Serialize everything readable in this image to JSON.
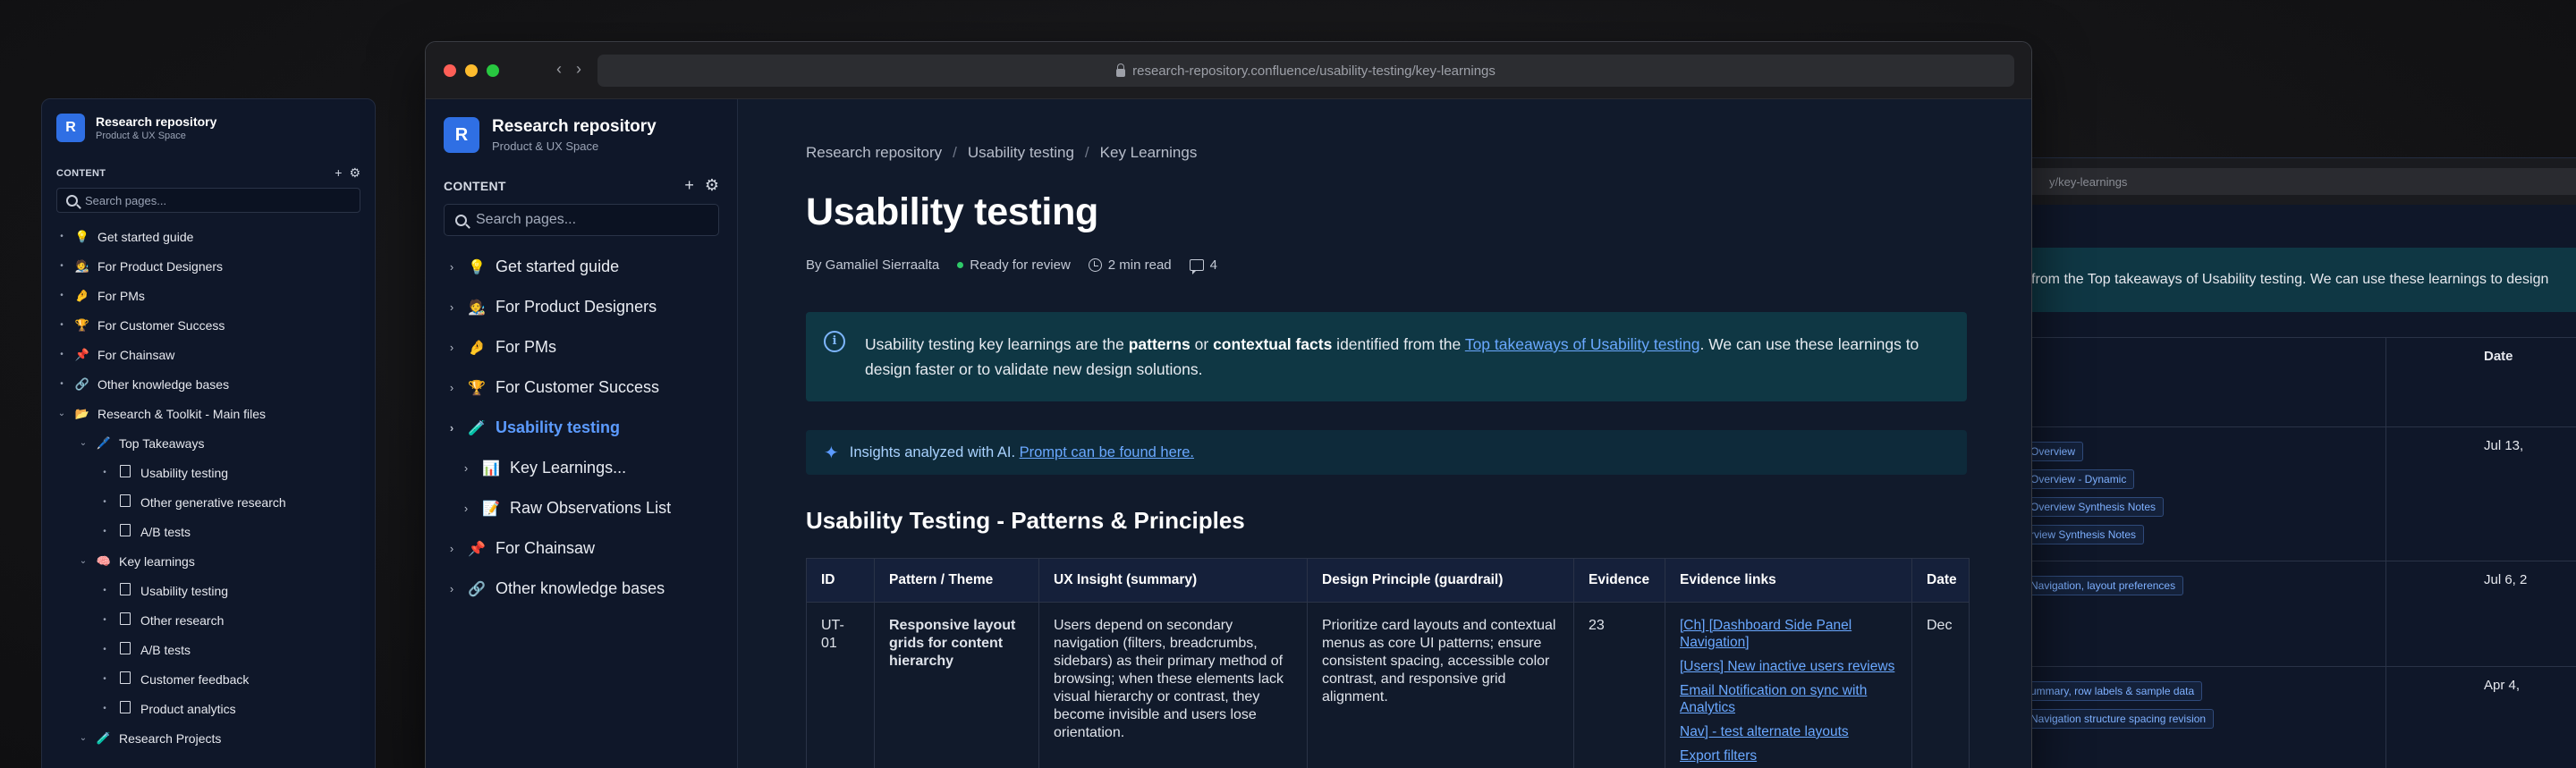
{
  "left_window": {
    "title": "Research repository",
    "subtitle": "Product & UX Space",
    "logo_letter": "R",
    "content_label": "CONTENT",
    "search_placeholder": "Search pages...",
    "items": [
      {
        "emoji": "💡",
        "label": "Get started guide",
        "level": 0,
        "chev": "•"
      },
      {
        "emoji": "🧑‍🎨",
        "label": "For Product Designers",
        "level": 0,
        "chev": "•"
      },
      {
        "emoji": "🤌",
        "label": "For PMs",
        "level": 0,
        "chev": "•"
      },
      {
        "emoji": "🏆",
        "label": "For Customer Success",
        "level": 0,
        "chev": "•"
      },
      {
        "emoji": "📌",
        "label": "For Chainsaw",
        "level": 0,
        "chev": "•"
      },
      {
        "emoji": "🔗",
        "label": "Other knowledge bases",
        "level": 0,
        "chev": "•"
      },
      {
        "emoji": "📂",
        "label": "Research & Toolkit - Main files",
        "level": 0,
        "chev": "⌄"
      },
      {
        "emoji": "🖊️",
        "label": "Top Takeaways",
        "level": 1,
        "chev": "⌄"
      },
      {
        "emoji": "doc",
        "label": "Usability testing",
        "level": 2,
        "chev": "•"
      },
      {
        "emoji": "doc",
        "label": "Other generative research",
        "level": 2,
        "chev": "•"
      },
      {
        "emoji": "doc",
        "label": "A/B tests",
        "level": 2,
        "chev": "•"
      },
      {
        "emoji": "🧠",
        "label": "Key learnings",
        "level": 1,
        "chev": "⌄"
      },
      {
        "emoji": "doc",
        "label": "Usability testing",
        "level": 2,
        "chev": "•"
      },
      {
        "emoji": "doc",
        "label": "Other research",
        "level": 2,
        "chev": "•"
      },
      {
        "emoji": "doc",
        "label": "A/B tests",
        "level": 2,
        "chev": "•"
      },
      {
        "emoji": "doc",
        "label": "Customer feedback",
        "level": 2,
        "chev": "•"
      },
      {
        "emoji": "doc",
        "label": "Product analytics",
        "level": 2,
        "chev": "•"
      },
      {
        "emoji": "🧪",
        "label": "Research Projects",
        "level": 1,
        "chev": "⌄"
      }
    ]
  },
  "right_window": {
    "url_fragment": "y/key-learnings",
    "callout_text": "from the Top takeaways of Usability testing. We can use these learnings to design",
    "date_header": "Date",
    "rows": [
      {
        "date": "Jul 13,",
        "chips": [
          "Overview",
          "Overview - Dynamic",
          "Overview Synthesis Notes",
          "rview Synthesis Notes"
        ]
      },
      {
        "date": "Jul 6, 2",
        "chips": [
          "Navigation, layout preferences"
        ]
      },
      {
        "date": "Apr 4,",
        "chips": [
          "ummary, row labels & sample data",
          "Navigation structure spacing revision"
        ]
      }
    ]
  },
  "browser": {
    "url": "research-repository.confluence/usability-testing/key-learnings",
    "back": "‹",
    "forward": "›"
  },
  "sidebar": {
    "logo_letter": "R",
    "title": "Research repository",
    "subtitle": "Product & UX Space",
    "content_label": "CONTENT",
    "add_icon": "+",
    "settings_icon": "⚙",
    "search_placeholder": "Search pages...",
    "items": [
      {
        "emoji": "💡",
        "label": "Get started guide",
        "active": false,
        "sub": false
      },
      {
        "emoji": "🧑‍🎨",
        "label": "For Product Designers",
        "active": false,
        "sub": false
      },
      {
        "emoji": "🤌",
        "label": "For PMs",
        "active": false,
        "sub": false
      },
      {
        "emoji": "🏆",
        "label": "For Customer Success",
        "active": false,
        "sub": false
      },
      {
        "emoji": "🧪",
        "label": "Usability testing",
        "active": true,
        "sub": false
      },
      {
        "emoji": "📊",
        "label": "Key Learnings...",
        "active": false,
        "sub": true
      },
      {
        "emoji": "📝",
        "label": "Raw Observations List",
        "active": false,
        "sub": true
      },
      {
        "emoji": "📌",
        "label": "For Chainsaw",
        "active": false,
        "sub": false
      },
      {
        "emoji": "🔗",
        "label": "Other knowledge bases",
        "active": false,
        "sub": false
      }
    ]
  },
  "page": {
    "breadcrumb": [
      "Research repository",
      "Usability testing",
      "Key Learnings"
    ],
    "title": "Usability testing",
    "meta": {
      "author": "By Gamaliel Sierraalta",
      "status": "Ready for review",
      "read_time": "2 min read",
      "comments": "4"
    },
    "info": {
      "icon": "i",
      "t1": "Usability testing key learnings are the ",
      "b1": "patterns",
      "t2": " or ",
      "b2": "contextual facts",
      "t3": " identified from the ",
      "link": "Top takeaways of Usability testing",
      "t4": ". We can use these learnings to design faster or to validate new design solutions."
    },
    "ai": {
      "text": "Insights analyzed with AI. ",
      "link": "Prompt can be found here."
    },
    "section_title": "Usability Testing - Patterns & Principles",
    "table": {
      "headers": [
        "ID",
        "Pattern / Theme",
        "UX Insight (summary)",
        "Design Principle (guardrail)",
        "Evidence",
        "Evidence links",
        "Date"
      ],
      "rows": [
        {
          "id": "UT-01",
          "pattern": "Responsive layout grids for content hierarchy",
          "insight": "Users depend on secondary navigation (filters, breadcrumbs, sidebars) as their primary method of browsing; when these elements lack visual hierarchy or contrast, they become invisible and users lose orientation.",
          "principle": "Prioritize card layouts and contextual menus as core UI patterns; ensure consistent spacing, accessible color contrast, and responsive grid alignment.",
          "evidence": "23",
          "links": [
            "[Ch] [Dashboard Side Panel Navigation]",
            "[Users] New inactive users reviews",
            "Email Notification on sync with Analytics",
            "Nav] - test alternate layouts",
            "Export filters"
          ],
          "date": "Dec"
        }
      ]
    }
  }
}
